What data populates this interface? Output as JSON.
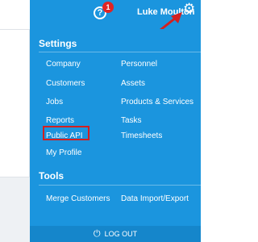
{
  "topbar": {
    "help_icon_glyph": "?",
    "notification_count": "1",
    "user_name": "Luke Moulton",
    "gear_icon": "gear-icon",
    "accent_color": "#1b95de"
  },
  "menu": {
    "settings_title": "Settings",
    "settings_left": [
      "Company",
      "Customers",
      "Jobs",
      "Reports",
      "Public API",
      "My Profile"
    ],
    "settings_right": [
      "Personnel",
      "Assets",
      "Products & Services",
      "Tasks",
      "Timesheets"
    ],
    "tools_title": "Tools",
    "tools_left": [
      "Merge Customers"
    ],
    "tools_right": [
      "Data Import/Export"
    ],
    "logout_label": "LOG OUT",
    "highlighted_item": "Public API",
    "highlight_color": "#d32020",
    "arrow_color": "#d32020"
  }
}
